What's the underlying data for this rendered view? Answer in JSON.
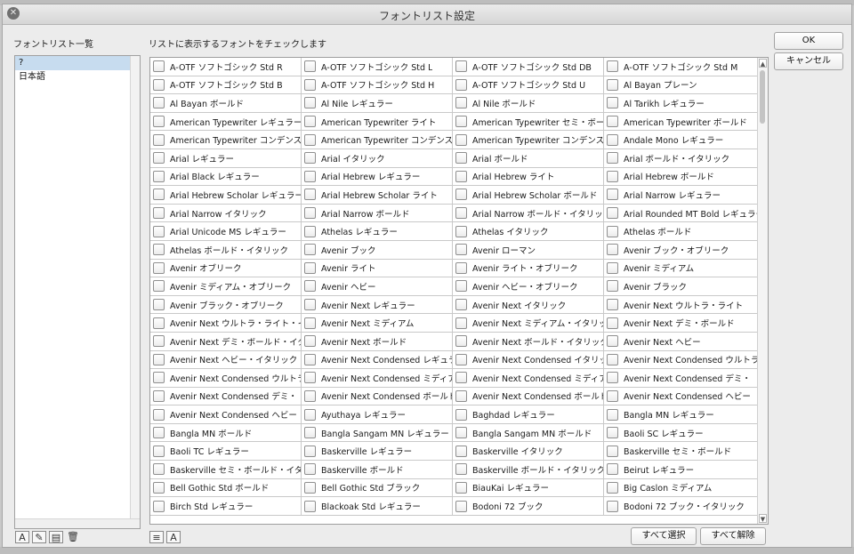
{
  "window": {
    "title": "フォントリスト設定"
  },
  "labels": {
    "list_heading": "フォントリスト一覧",
    "check_instruction": "リストに表示するフォントをチェックします"
  },
  "buttons": {
    "ok": "OK",
    "cancel": "キャンセル",
    "select_all": "すべて選択",
    "deselect_all": "すべて解除"
  },
  "font_lists": [
    {
      "label": "?",
      "selected": true
    },
    {
      "label": "日本語",
      "selected": false
    }
  ],
  "icons": {
    "close": "close-icon",
    "new_list": "new-font-list-icon",
    "edit_list": "edit-font-list-icon",
    "duplicate_list": "duplicate-font-list-icon",
    "delete_list": "trash-icon",
    "sort_a": "sort-fonts-icon",
    "font_a": "font-preview-icon"
  },
  "fonts": [
    "A-OTF ソフトゴシック Std R",
    "A-OTF ソフトゴシック Std L",
    "A-OTF ソフトゴシック Std DB",
    "A-OTF ソフトゴシック Std M",
    "A-OTF ソフトゴシック Std B",
    "A-OTF ソフトゴシック Std H",
    "A-OTF ソフトゴシック Std U",
    "Al Bayan プレーン",
    "Al Bayan ボールド",
    "Al Nile レギュラー",
    "Al Nile ボールド",
    "Al Tarikh レギュラー",
    "American Typewriter レギュラー",
    "American Typewriter ライト",
    "American Typewriter セミ・ボールド",
    "American Typewriter ボールド",
    "American Typewriter コンデンス",
    "American Typewriter コンデンス",
    "American Typewriter コンデンス",
    "Andale Mono レギュラー",
    "Arial レギュラー",
    "Arial イタリック",
    "Arial ボールド",
    "Arial ボールド・イタリック",
    "Arial Black レギュラー",
    "Arial Hebrew レギュラー",
    "Arial Hebrew ライト",
    "Arial Hebrew ボールド",
    "Arial Hebrew Scholar レギュラー",
    "Arial Hebrew Scholar ライト",
    "Arial Hebrew Scholar ボールド",
    "Arial Narrow レギュラー",
    "Arial Narrow イタリック",
    "Arial Narrow ボールド",
    "Arial Narrow ボールド・イタリック",
    "Arial Rounded MT Bold レギュラー",
    "Arial Unicode MS レギュラー",
    "Athelas レギュラー",
    "Athelas イタリック",
    "Athelas ボールド",
    "Athelas ボールド・イタリック",
    "Avenir ブック",
    "Avenir ローマン",
    "Avenir ブック・オブリーク",
    "Avenir オブリーク",
    "Avenir ライト",
    "Avenir ライト・オブリーク",
    "Avenir ミディアム",
    "Avenir ミディアム・オブリーク",
    "Avenir ヘビー",
    "Avenir ヘビー・オブリーク",
    "Avenir ブラック",
    "Avenir ブラック・オブリーク",
    "Avenir Next レギュラー",
    "Avenir Next イタリック",
    "Avenir Next ウルトラ・ライト",
    "Avenir Next ウルトラ・ライト・イタリック",
    "Avenir Next ミディアム",
    "Avenir Next ミディアム・イタリック",
    "Avenir Next デミ・ボールド",
    "Avenir Next デミ・ボールド・イタリック",
    "Avenir Next ボールド",
    "Avenir Next ボールド・イタリック",
    "Avenir Next ヘビー",
    "Avenir Next ヘビー・イタリック",
    "Avenir Next Condensed レギュラー",
    "Avenir Next Condensed イタリック",
    "Avenir Next Condensed ウルトラ",
    "Avenir Next Condensed ウルトラ",
    "Avenir Next Condensed ミディアム",
    "Avenir Next Condensed ミディアム",
    "Avenir Next Condensed デミ・",
    "Avenir Next Condensed デミ・",
    "Avenir Next Condensed ボールド",
    "Avenir Next Condensed ボールド",
    "Avenir Next Condensed ヘビー",
    "Avenir Next Condensed ヘビー",
    "Ayuthaya レギュラー",
    "Baghdad レギュラー",
    "Bangla MN レギュラー",
    "Bangla MN ボールド",
    "Bangla Sangam MN レギュラー",
    "Bangla Sangam MN ボールド",
    "Baoli SC レギュラー",
    "Baoli TC レギュラー",
    "Baskerville レギュラー",
    "Baskerville イタリック",
    "Baskerville セミ・ボールド",
    "Baskerville セミ・ボールド・イタリック",
    "Baskerville ボールド",
    "Baskerville ボールド・イタリック",
    "Beirut レギュラー",
    "Bell Gothic Std ボールド",
    "Bell Gothic Std ブラック",
    "BiauKai レギュラー",
    "Big Caslon ミディアム",
    "Birch Std レギュラー",
    "Blackoak Std レギュラー",
    "Bodoni 72 ブック",
    "Bodoni 72 ブック・イタリック"
  ]
}
